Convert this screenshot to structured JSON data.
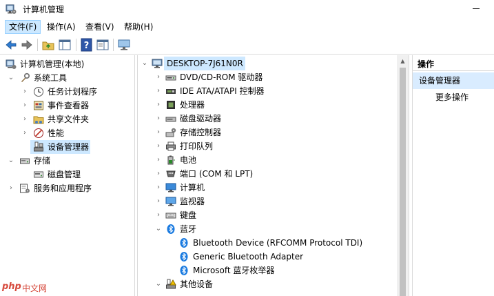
{
  "window": {
    "title": "计算机管理"
  },
  "menu": [
    {
      "label": "文件(F)",
      "active": true
    },
    {
      "label": "操作(A)"
    },
    {
      "label": "查看(V)"
    },
    {
      "label": "帮助(H)"
    }
  ],
  "toolbar": {
    "buttons": [
      "back-arrow-icon",
      "forward-arrow-icon",
      "up-folder-icon",
      "show-hide-tree-icon",
      "help-icon",
      "properties-icon",
      "monitor-icon"
    ]
  },
  "left_tree": {
    "root": "计算机管理(本地)",
    "system_tools": "系统工具",
    "task_scheduler": "任务计划程序",
    "event_viewer": "事件查看器",
    "shared_folders": "共享文件夹",
    "performance": "性能",
    "device_manager": "设备管理器",
    "storage": "存储",
    "disk_management": "磁盘管理",
    "services_apps": "服务和应用程序"
  },
  "device_tree": {
    "root": "DESKTOP-7J61N0R",
    "categories": [
      "DVD/CD-ROM 驱动器",
      "IDE ATA/ATAPI 控制器",
      "处理器",
      "磁盘驱动器",
      "存储控制器",
      "打印队列",
      "电池",
      "端口 (COM 和 LPT)",
      "计算机",
      "监视器",
      "键盘",
      "蓝牙"
    ],
    "bluetooth_children": [
      "Bluetooth Device (RFCOMM Protocol TDI)",
      "Generic Bluetooth Adapter",
      "Microsoft 蓝牙枚举器"
    ],
    "other_devices": "其他设备"
  },
  "actions": {
    "header": "操作",
    "section": "设备管理器",
    "more": "更多操作"
  },
  "watermark": {
    "brand": "php",
    "text": "中文网"
  },
  "colors": {
    "selection": "#cde8ff",
    "accent": "#0078d7",
    "bluetooth": "#1b7be0"
  }
}
